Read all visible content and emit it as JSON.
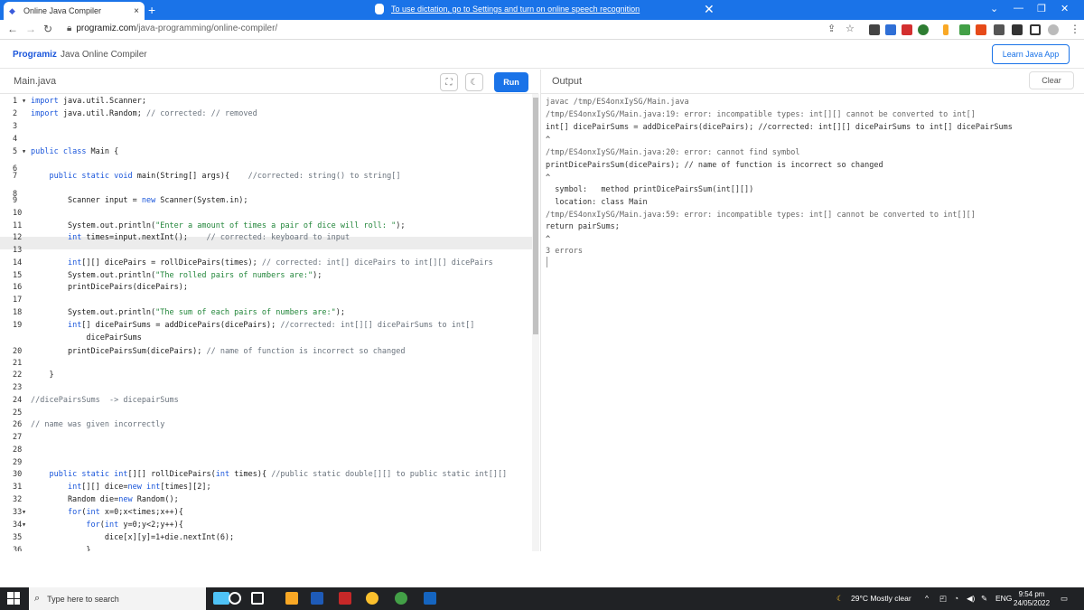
{
  "browser": {
    "tab_title": "Online Java Compiler",
    "tab_close": "×",
    "new_tab": "+",
    "dictation_message": "To use dictation, go to Settings and turn on online speech recognition",
    "dictation_close": "✕",
    "url_domain": "programiz.com",
    "url_path": "/java-programming/online-compiler/"
  },
  "app": {
    "logo": "Programiz",
    "title": "Java Online Compiler",
    "learn_button": "Learn Java App"
  },
  "editor": {
    "filename": "Main.java",
    "run_label": "Run",
    "lines": [
      {
        "n": "1",
        "fold": true,
        "code": "import java.util.Scanner;"
      },
      {
        "n": "2",
        "fold": false,
        "code": "import java.util.Random; // corrected: // removed"
      },
      {
        "n": "3",
        "fold": false,
        "code": ""
      },
      {
        "n": "4",
        "fold": false,
        "code": ""
      },
      {
        "n": "5",
        "fold": true,
        "code": "public class Main {"
      },
      {
        "n": "6",
        "fold": false,
        "code": ""
      },
      {
        "n": "7",
        "fold": false,
        "code": "    public static void main(String[] args){    //corrected: string() to string[]"
      },
      {
        "n": "8",
        "fold": false,
        "code": ""
      },
      {
        "n": "9",
        "fold": false,
        "code": "        Scanner input = new Scanner(System.in);"
      },
      {
        "n": "10",
        "fold": false,
        "code": ""
      },
      {
        "n": "11",
        "fold": false,
        "code": "        System.out.println(\"Enter a amount of times a pair of dice will roll: \");"
      },
      {
        "n": "12",
        "fold": false,
        "code": "        int times=input.nextInt();    // corrected: keyboard to input"
      },
      {
        "n": "13",
        "fold": false,
        "code": ""
      },
      {
        "n": "14",
        "fold": false,
        "code": "        int[][] dicePairs = rollDicePairs(times); // corrected: int[] dicePairs to int[][] dicePairs"
      },
      {
        "n": "15",
        "fold": false,
        "code": "        System.out.println(\"The rolled pairs of numbers are:\");"
      },
      {
        "n": "16",
        "fold": false,
        "code": "        printDicePairs(dicePairs);"
      },
      {
        "n": "17",
        "fold": false,
        "code": ""
      },
      {
        "n": "18",
        "fold": false,
        "code": "        System.out.println(\"The sum of each pairs of numbers are:\");"
      },
      {
        "n": "19",
        "fold": false,
        "code": "        int[] dicePairSums = addDicePairs(dicePairs); //corrected: int[][] dicePairSums to int[]"
      },
      {
        "n": "",
        "fold": false,
        "code": "            dicePairSums"
      },
      {
        "n": "20",
        "fold": false,
        "code": "        printDicePairsSum(dicePairs); // name of function is incorrect so changed"
      },
      {
        "n": "21",
        "fold": false,
        "code": ""
      },
      {
        "n": "22",
        "fold": false,
        "code": "    }"
      },
      {
        "n": "23",
        "fold": false,
        "code": ""
      },
      {
        "n": "24",
        "fold": false,
        "code": "//dicePairsSums  -> dicepairSums"
      },
      {
        "n": "25",
        "fold": false,
        "code": ""
      },
      {
        "n": "26",
        "fold": false,
        "code": "// name was given incorrectly"
      },
      {
        "n": "27",
        "fold": false,
        "code": ""
      },
      {
        "n": "28",
        "fold": false,
        "code": ""
      },
      {
        "n": "29",
        "fold": false,
        "code": ""
      },
      {
        "n": "30",
        "fold": false,
        "code": "    public static int[][] rollDicePairs(int times){ //public static double[][] to public static int[][]"
      },
      {
        "n": "31",
        "fold": false,
        "code": "        int[][] dice=new int[times][2];"
      },
      {
        "n": "32",
        "fold": false,
        "code": "        Random die=new Random();"
      },
      {
        "n": "33",
        "fold": true,
        "code": "        for(int x=0;x<times;x++){"
      },
      {
        "n": "34",
        "fold": true,
        "code": "            for(int y=0;y<2;y++){"
      },
      {
        "n": "35",
        "fold": false,
        "code": "                dice[x][y]=1+die.nextInt(6);"
      },
      {
        "n": "36",
        "fold": false,
        "code": "            }"
      }
    ]
  },
  "output": {
    "title": "Output",
    "clear_label": "Clear",
    "lines": [
      "javac /tmp/ES4onxIySG/Main.java",
      "/tmp/ES4onxIySG/Main.java:19: error: incompatible types: int[][] cannot be converted to int[]",
      "int[] dicePairSums = addDicePairs(dicePairs); //corrected: int[][] dicePairSums to int[] dicePairSums",
      "^",
      "/tmp/ES4onxIySG/Main.java:20: error: cannot find symbol",
      "printDicePairsSum(dicePairs); // name of function is incorrect so changed",
      "^",
      "  symbol:   method printDicePairsSum(int[][])",
      "  location: class Main",
      "/tmp/ES4onxIySG/Main.java:59: error: incompatible types: int[] cannot be converted to int[][]",
      "return pairSums;",
      "^",
      "3 errors"
    ]
  },
  "taskbar": {
    "search_placeholder": "Type here to search",
    "weather": "29°C  Mostly clear",
    "language": "ENG",
    "time": "9:54 pm",
    "date": "24/05/2022"
  },
  "colors": {
    "keyword": "#1a56db",
    "comment": "#6a737d",
    "string": "#22863a",
    "accent": "#1a73e8"
  }
}
